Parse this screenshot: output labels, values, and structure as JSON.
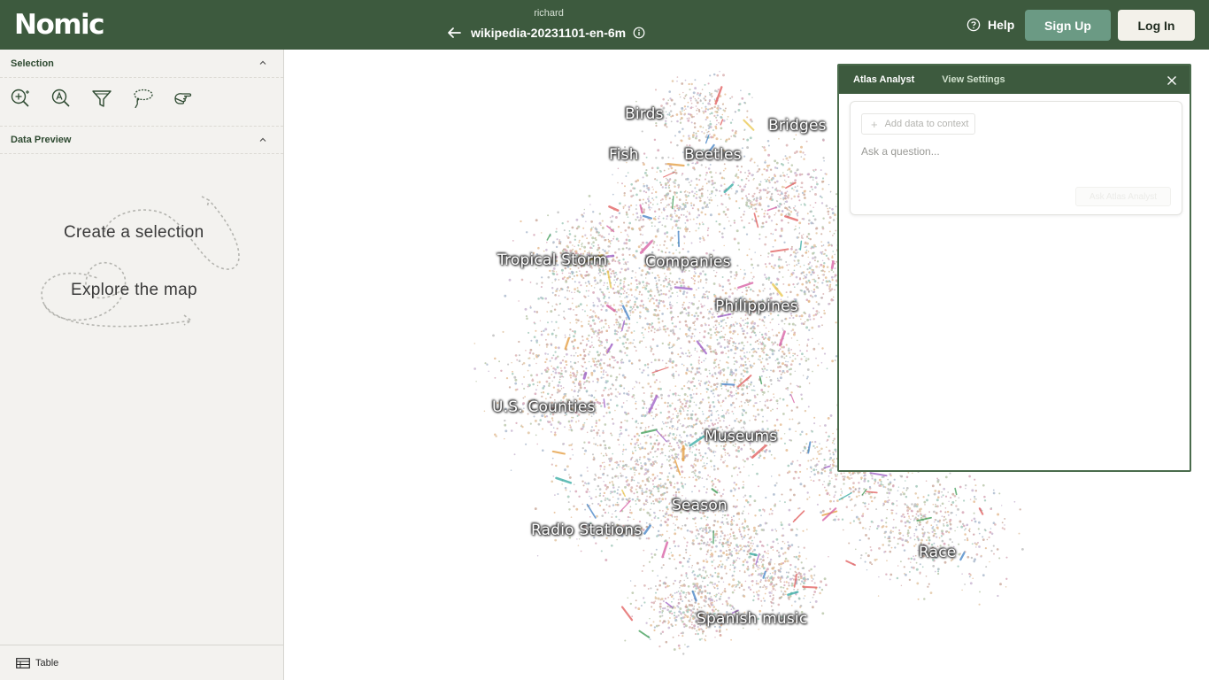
{
  "header": {
    "logo_text": "Nomic",
    "owner": "richard",
    "map_title": "wikipedia-20231101-en-6m",
    "help_label": "Help",
    "signup_label": "Sign Up",
    "login_label": "Log In",
    "colors": {
      "bar": "#3d5a3e",
      "signup": "#6b9a84",
      "login": "#f3f1ea"
    }
  },
  "sidebar": {
    "selection_title": "Selection",
    "tools": [
      "zoom-in-icon",
      "lexical-search-icon",
      "filter-icon",
      "lasso-icon",
      "hand-pointer-icon"
    ],
    "preview_title": "Data Preview",
    "hint_create": "Create a selection",
    "hint_explore": "Explore the map",
    "table_label": "Table"
  },
  "map": {
    "labels": [
      "Birds",
      "Bridges",
      "Fish",
      "Beetles",
      "Tropical Storm",
      "Companies",
      "Philippines",
      "U.S. Counties",
      "Museums",
      "Season",
      "Radio Stations",
      "Race",
      "Spanish music"
    ]
  },
  "analyst": {
    "tab_active": "Atlas Analyst",
    "tab_settings": "View Settings",
    "add_context_label": "Add data to context",
    "question_placeholder": "Ask a question...",
    "send_label": "Ask Atlas Analyst"
  }
}
